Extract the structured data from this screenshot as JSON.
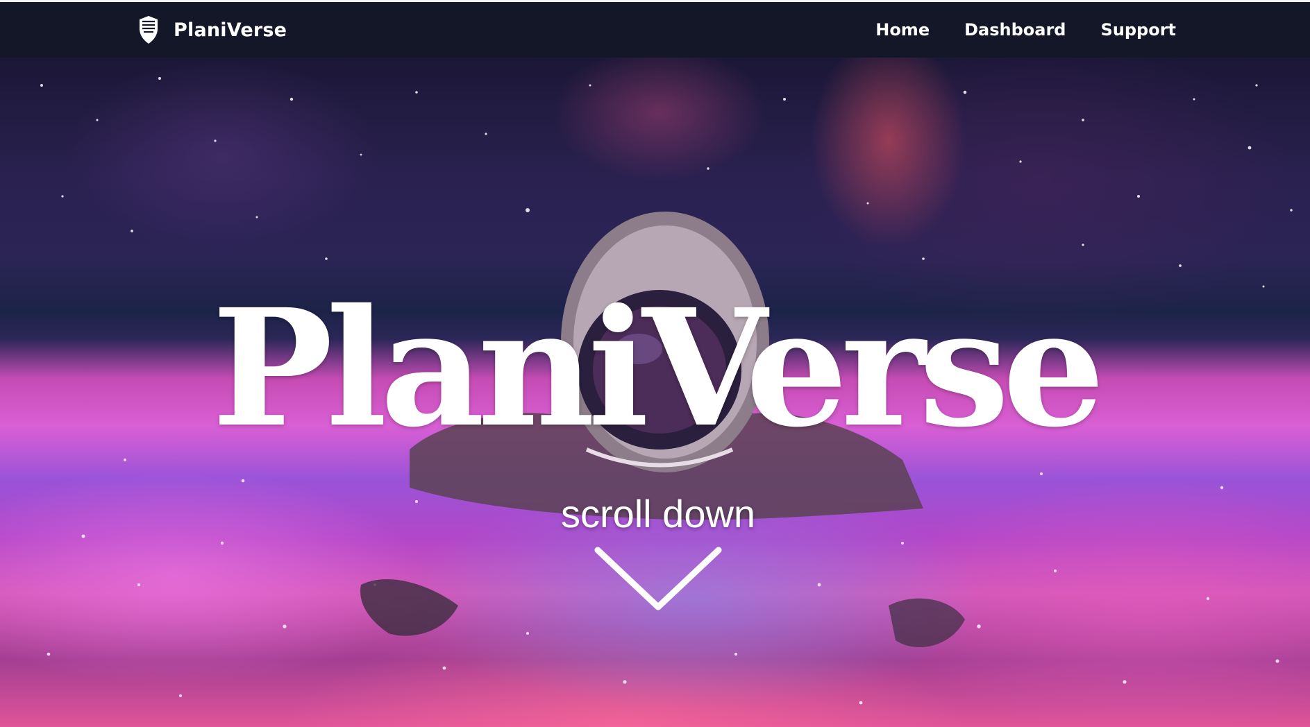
{
  "brand": {
    "name": "PlaniVerse",
    "icon": "shield-logo-icon"
  },
  "nav": {
    "items": [
      {
        "label": "Home"
      },
      {
        "label": "Dashboard"
      },
      {
        "label": "Support"
      }
    ]
  },
  "hero": {
    "title": "PlaniVerse",
    "scroll_label": "scroll down",
    "scroll_icon": "chevron-down-icon"
  },
  "colors": {
    "navbar": "#141727",
    "text": "#ffffff"
  }
}
